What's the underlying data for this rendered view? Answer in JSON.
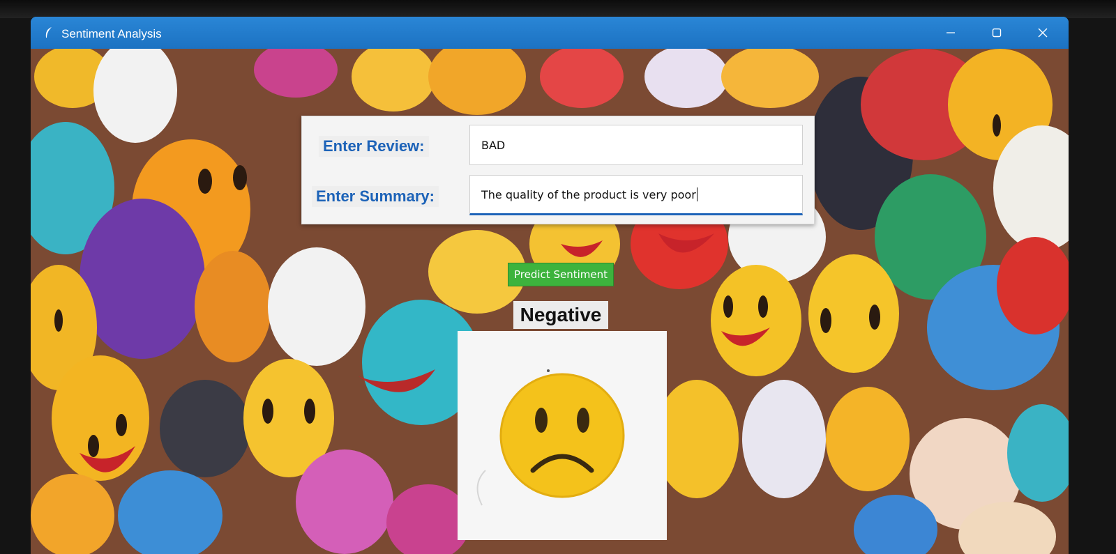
{
  "window": {
    "title": "Sentiment Analysis",
    "controls": [
      "minimize-icon",
      "maximize-icon",
      "close-icon"
    ]
  },
  "form": {
    "review_label": "Enter Review:",
    "review_value": "BAD",
    "summary_label": "Enter Summary:",
    "summary_value": "The  quality of the product is very poor"
  },
  "action": {
    "predict_label": "Predict Sentiment"
  },
  "result": {
    "sentiment": "Negative",
    "icon": "sad-face-icon"
  },
  "colors": {
    "titlebar": "#1f78c8",
    "label_text": "#1d63b8",
    "predict_button": "#3db33d",
    "face_yellow": "#f4c21b"
  }
}
